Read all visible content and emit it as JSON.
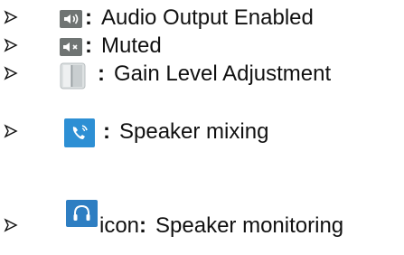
{
  "legend": {
    "items": [
      {
        "icon": "speaker-on-icon",
        "separator": ":",
        "text": "Audio Output Enabled"
      },
      {
        "icon": "speaker-muted-icon",
        "separator": ":",
        "text": "Muted"
      },
      {
        "icon": "gain-slider-icon",
        "separator": ":",
        "text": "Gain Level Adjustment"
      },
      {
        "icon": "phone-mixing-icon",
        "separator": ":",
        "text": "Speaker mixing"
      },
      {
        "icon": "headphones-icon",
        "prefix": "icon",
        "separator": ":",
        "text": "Speaker monitoring"
      }
    ]
  },
  "colors": {
    "icon_gray": "#6f7473",
    "phone_blue": "#2d8fd4",
    "headphone_blue": "#2e7ec2",
    "slider_gray": "#b8bec0",
    "text": "#111111"
  }
}
